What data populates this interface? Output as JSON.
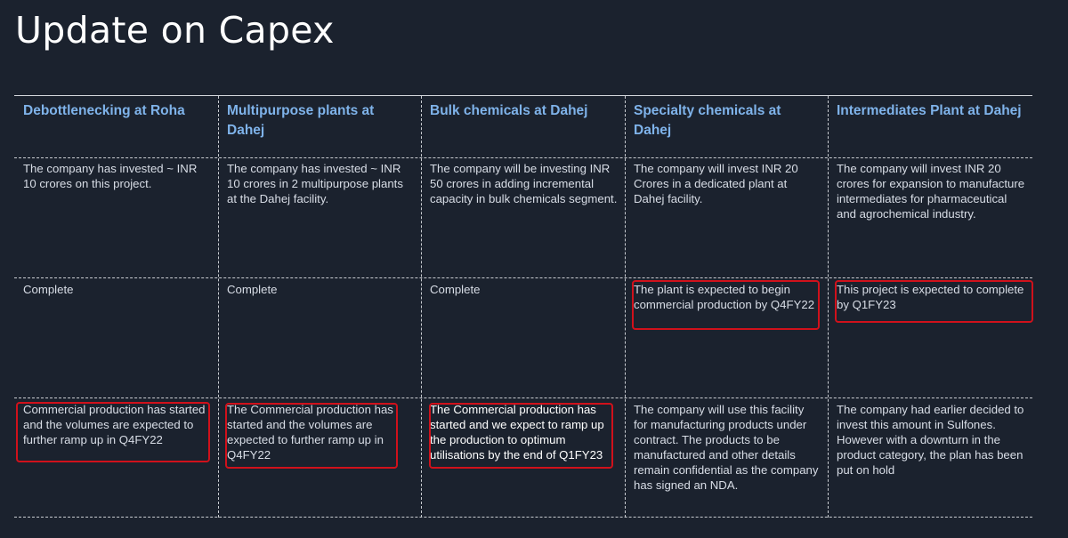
{
  "title": "Update on Capex",
  "columns": [
    {
      "heading": "Debottlenecking at Roha",
      "investment": "The company has invested ~ INR 10 crores on this project.",
      "status": "Complete",
      "remarks": "Commercial production has started and the volumes are expected to further ramp up in Q4FY22"
    },
    {
      "heading": "Multipurpose plants at Dahej",
      "investment": "The company  has invested ~ INR 10 crores in 2 multipurpose plants at the Dahej facility.",
      "status": "Complete",
      "remarks": "The Commercial production has started and the volumes are expected to further ramp up in Q4FY22"
    },
    {
      "heading": "Bulk chemicals at Dahej",
      "investment": "The company will be investing INR 50 crores in adding incremental capacity in bulk chemicals segment.",
      "status": "Complete",
      "remarks": "The Commercial production has started and we expect to ramp up the production to optimum utilisations by the end of Q1FY23"
    },
    {
      "heading": "Specialty chemicals at Dahej",
      "investment": "The company will invest INR 20 Crores in a dedicated plant at Dahej facility.",
      "status": "The plant is expected to begin commercial production by Q4FY22",
      "remarks": "The company will use this facility for manufacturing products under contract. The products to be manufactured and other details remain confidential as the company has signed an NDA."
    },
    {
      "heading": "Intermediates Plant at Dahej",
      "investment": "The company  will invest INR 20 crores for expansion to manufacture intermediates for pharmaceutical and agrochemical industry.",
      "status": "This project is expected to complete by Q1FY23",
      "remarks": "The company had earlier decided to invest this amount in Sulfones. However with a downturn in the product category, the plan has been put on hold"
    }
  ],
  "colors": {
    "background": "#1b222e",
    "heading": "#7fb3ea",
    "highlight": "#d0111b"
  }
}
